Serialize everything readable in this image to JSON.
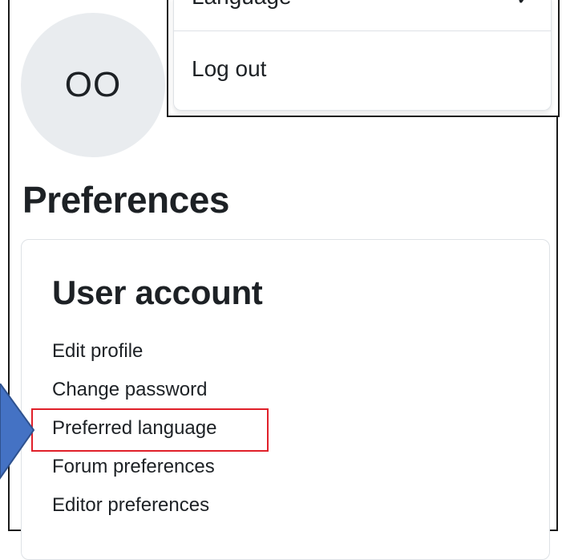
{
  "profile": {
    "initials": "OO"
  },
  "user_menu": {
    "language_label": "Language",
    "language_check": "✓",
    "logout_label": "Log out"
  },
  "page": {
    "title": "Preferences"
  },
  "user_account": {
    "title": "User account",
    "links": [
      "Edit profile",
      "Change password",
      "Preferred language",
      "Forum preferences",
      "Editor preferences"
    ]
  },
  "annotations": {
    "highlight_color": "#e0202a",
    "arrow_color": "#4472c4"
  }
}
